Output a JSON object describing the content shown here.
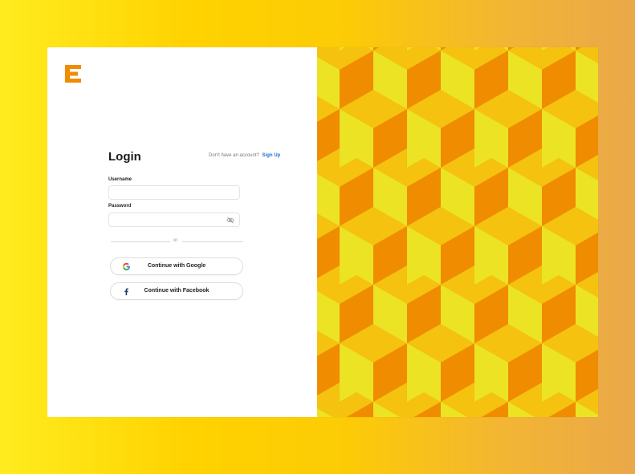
{
  "brand": {
    "logo_icon": "e-logo-icon",
    "logo_color": "#f08c00"
  },
  "login": {
    "title": "Login",
    "signup_prompt": "Don't have an account?",
    "signup_link": "Sign Up",
    "username_label": "Username",
    "username_value": "",
    "password_label": "Password",
    "password_value": "",
    "password_toggle_icon": "eye-off-icon",
    "divider_text": "or",
    "google_button": "Continue with Google",
    "facebook_button": "Continue with Facebook"
  },
  "colors": {
    "accent_link": "#1d6fd6",
    "cube_light": "#ebe324",
    "cube_mid": "#f4c20f",
    "cube_dark": "#f08c00"
  },
  "decoration": {
    "pattern": "isometric-cubes"
  }
}
